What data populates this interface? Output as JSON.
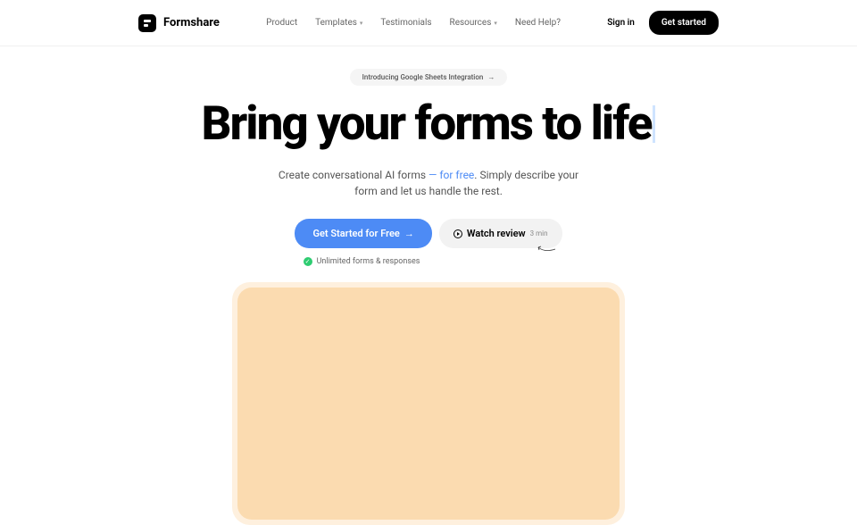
{
  "header": {
    "logo_text": "Formshare",
    "nav": {
      "product": "Product",
      "templates": "Templates",
      "testimonials": "Testimonials",
      "resources": "Resources",
      "help": "Need Help?"
    },
    "signin": "Sign in",
    "get_started": "Get started"
  },
  "hero": {
    "announcement": "Introducing Google Sheets Integration",
    "title": "Bring your forms to life",
    "subtitle_pre": "Create conversational AI forms ",
    "subtitle_highlight": "— for free",
    "subtitle_post": ". Simply describe your form and let us handle the rest.",
    "cta_primary": "Get Started for Free",
    "cta_secondary": "Watch review",
    "cta_duration": "3 min",
    "feature": "Unlimited forms & responses"
  }
}
